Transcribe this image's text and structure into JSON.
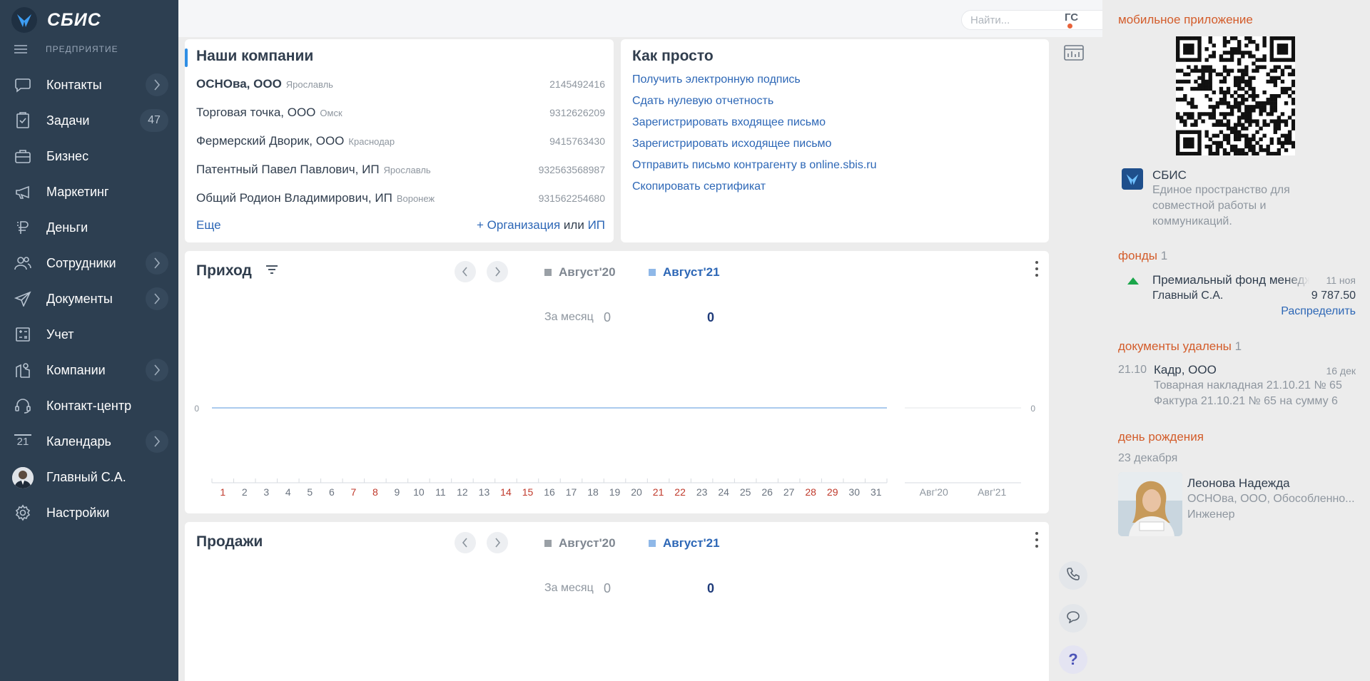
{
  "app": {
    "logo_text": "СБИС",
    "section": "ПРЕДПРИЯТИЕ"
  },
  "sidebar": {
    "items": [
      {
        "label": "Контакты",
        "icon": "chat-bubble-icon",
        "chevron": true
      },
      {
        "label": "Задачи",
        "icon": "tasks-checklist-icon",
        "count": "47"
      },
      {
        "label": "Бизнес",
        "icon": "briefcase-icon"
      },
      {
        "label": "Маркетинг",
        "icon": "megaphone-icon"
      },
      {
        "label": "Деньги",
        "icon": "ruble-icon"
      },
      {
        "label": "Сотрудники",
        "icon": "people-icon",
        "chevron": true
      },
      {
        "label": "Документы",
        "icon": "paper-plane-icon",
        "chevron": true
      },
      {
        "label": "Учет",
        "icon": "calculator-icon"
      },
      {
        "label": "Компании",
        "icon": "building-pin-icon",
        "chevron": true
      },
      {
        "label": "Контакт-центр",
        "icon": "headset-icon"
      },
      {
        "label": "Календарь",
        "icon": "calendar-icon",
        "calendar_day": "21",
        "chevron": true
      },
      {
        "label": "Главный С.А.",
        "icon": "user-avatar"
      },
      {
        "label": "Настройки",
        "icon": "gear-icon"
      }
    ]
  },
  "header": {
    "search_placeholder": "Найти...",
    "user_initials": "ГС"
  },
  "companies": {
    "title": "Наши компании",
    "rows": [
      {
        "name": "ОСНОва, ООО",
        "city": "Ярославль",
        "inn": "2145492416",
        "bold": true
      },
      {
        "name": "Торговая точка, ООО",
        "city": "Омск",
        "inn": "9312626209"
      },
      {
        "name": "Фермерский Дворик, ООО",
        "city": "Краснодар",
        "inn": "9415763430"
      },
      {
        "name": "Патентный Павел Павлович, ИП",
        "city": "Ярославль",
        "inn": "932563568987"
      },
      {
        "name": "Общий Родион Владимирович, ИП",
        "city": "Воронеж",
        "inn": "931562254680"
      }
    ],
    "more": "Еще",
    "add_org": "+ Организация",
    "or": "или",
    "add_ip": "ИП"
  },
  "howto": {
    "title": "Как просто",
    "links": [
      "Получить электронную подпись",
      "Сдать нулевую отчетность",
      "Зарегистрировать входящее письмо",
      "Зарегистрировать исходящее письмо",
      "Отправить письмо контрагенту в online.sbis.ru",
      "Скопировать сертификат"
    ]
  },
  "income": {
    "title": "Приход",
    "legend_prev": "Август'20",
    "legend_curr": "Август'21",
    "month_label": "За месяц",
    "prev_value": "0",
    "curr_value": "0",
    "y_zero": "0"
  },
  "sales": {
    "title": "Продажи",
    "legend_prev": "Август'20",
    "legend_curr": "Август'21",
    "month_label": "За месяц",
    "prev_value": "0",
    "curr_value": "0"
  },
  "chart_data": [
    {
      "type": "line",
      "title": "Приход",
      "x": [
        "1",
        "2",
        "3",
        "4",
        "5",
        "6",
        "7",
        "8",
        "9",
        "10",
        "11",
        "12",
        "13",
        "14",
        "15",
        "16",
        "17",
        "18",
        "19",
        "20",
        "21",
        "22",
        "23",
        "24",
        "25",
        "26",
        "27",
        "28",
        "29",
        "30",
        "31"
      ],
      "weekend_days": [
        "1",
        "7",
        "8",
        "14",
        "15",
        "21",
        "22",
        "28",
        "29"
      ],
      "series": [
        {
          "name": "Август'21",
          "values": [
            0,
            0,
            0,
            0,
            0,
            0,
            0,
            0,
            0,
            0,
            0,
            0,
            0,
            0,
            0,
            0,
            0,
            0,
            0,
            0,
            0,
            0,
            0,
            0,
            0,
            0,
            0,
            0,
            0,
            0,
            0
          ]
        }
      ],
      "y_tick": "0",
      "colors": {
        "prev": "#9aa0a6",
        "curr": "#8fb8e8"
      }
    },
    {
      "type": "bar",
      "title": "Приход",
      "categories": [
        "Авг'20",
        "Авг'21"
      ],
      "values": [
        0,
        0
      ],
      "y_tick": "0"
    }
  ],
  "right_panel": {
    "mobile": {
      "heading": "мобильное приложение",
      "app_name": "СБИС",
      "desc_lines": [
        "Единое пространство для",
        "совместной работы и",
        "коммуникаций."
      ]
    },
    "funds": {
      "heading": "фонды",
      "count": "1",
      "name": "Премиальный фонд менеджеров",
      "date": "11 ноя",
      "person": "Главный С.А.",
      "amount": "9 787.50",
      "action": "Распределить"
    },
    "deleted": {
      "heading": "документы удалены",
      "count": "1",
      "date_left": "21.10",
      "company": "Кадр, ООО",
      "date_right": "16 дек",
      "line1": "Товарная накладная 21.10.21 № 65",
      "line2": "Фактура 21.10.21 № 65 на сумму 6"
    },
    "birthday": {
      "heading": "день рождения",
      "date": "23 декабря",
      "name": "Леонова Надежда",
      "org": "ОСНОва, ООО, Обособленно...",
      "role": "Инженер"
    }
  },
  "colors": {
    "sidebar": "#2d3f51",
    "accent_blue": "#2d67b6",
    "accent_orange": "#d35c2a",
    "weekend_red": "#c0392b"
  }
}
